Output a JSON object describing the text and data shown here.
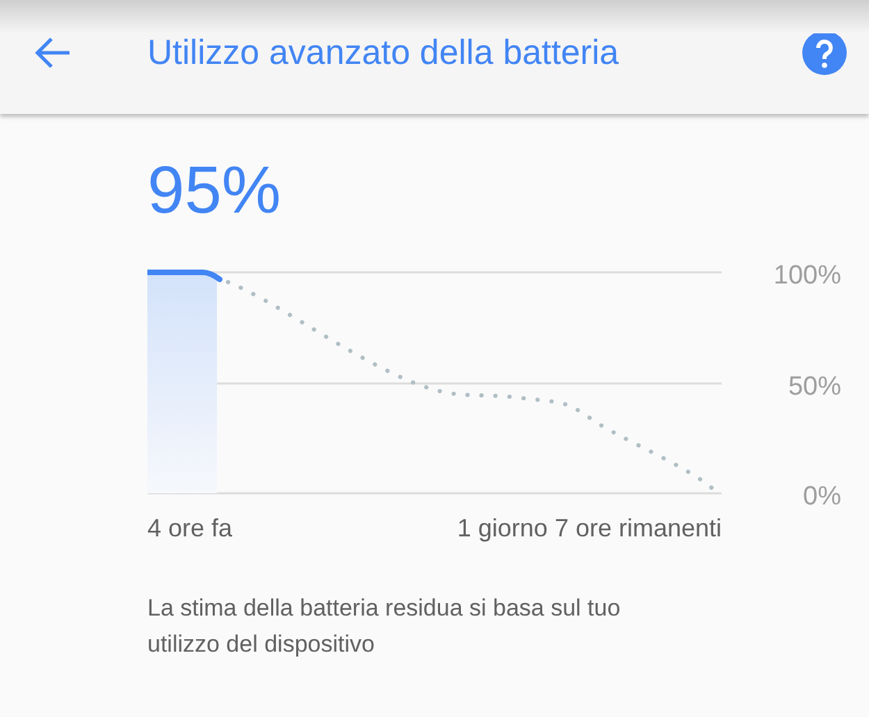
{
  "app_bar": {
    "title": "Utilizzo avanzato della batteria"
  },
  "battery_level": "95%",
  "chart": {
    "y_labels": [
      "100%",
      "50%",
      "0%"
    ],
    "x_labels": [
      "4 ore fa",
      "1 giorno 7 ore rimanenti"
    ]
  },
  "footnote": "La stima della batteria residua si basa sul tuo utilizzo del dispositivo"
}
